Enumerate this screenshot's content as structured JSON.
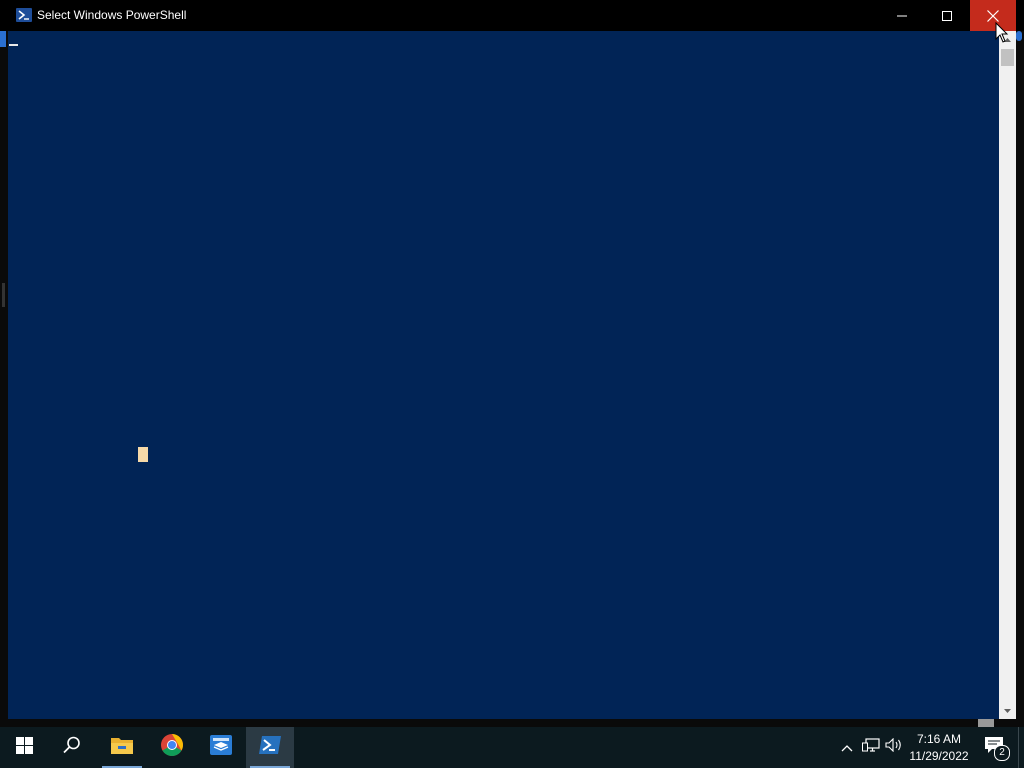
{
  "window": {
    "title": "Select Windows PowerShell",
    "console_bg": "#012456",
    "caption_buttons": {
      "minimize_icon": "minimize-icon",
      "maximize_icon": "maximize-icon",
      "close_icon": "close-icon"
    },
    "close_hover_color": "#c42b1c"
  },
  "taskbar": {
    "items": [
      {
        "name": "start",
        "icon": "windows-logo-icon"
      },
      {
        "name": "search",
        "icon": "search-icon"
      },
      {
        "name": "file-explorer",
        "icon": "folder-icon"
      },
      {
        "name": "chrome",
        "icon": "chrome-icon"
      },
      {
        "name": "sandbox",
        "icon": "sandbox-icon"
      },
      {
        "name": "powershell",
        "icon": "powershell-icon",
        "active": true
      }
    ],
    "tray": {
      "chevron_icon": "chevron-up-icon",
      "network_icon": "network-icon",
      "volume_icon": "volume-icon"
    },
    "clock": {
      "time": "7:16 AM",
      "date": "11/29/2022"
    },
    "notifications": {
      "count": "2"
    }
  }
}
